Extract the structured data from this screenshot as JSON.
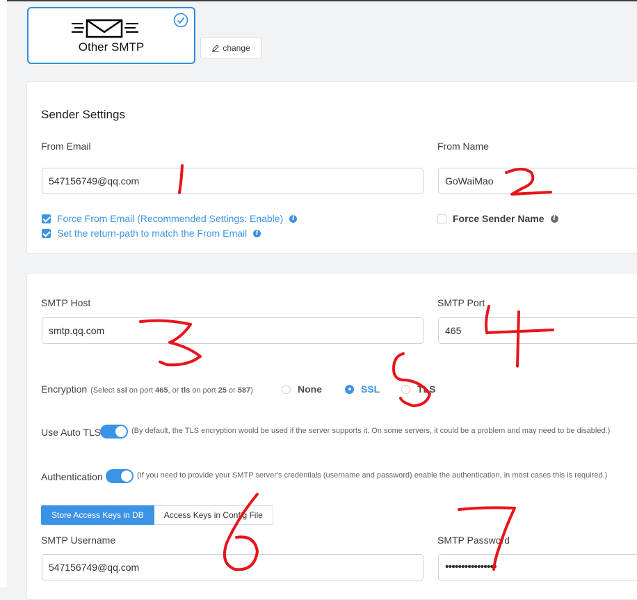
{
  "provider": {
    "name": "Other SMTP",
    "change_label": "change"
  },
  "sender": {
    "title": "Sender Settings",
    "from_email_label": "From Email",
    "from_email_value": "547156749@qq.com",
    "from_name_label": "From Name",
    "from_name_value": "GoWaiMao",
    "force_from_email_label": "Force From Email (Recommended Settings: Enable)",
    "force_from_email_checked": true,
    "return_path_label": "Set the return-path to match the From Email",
    "return_path_checked": true,
    "force_sender_name_label": "Force Sender Name",
    "force_sender_name_checked": false
  },
  "smtp": {
    "host_label": "SMTP Host",
    "host_value": "smtp.qq.com",
    "port_label": "SMTP Port",
    "port_value": "465",
    "encryption_label": "Encryption",
    "encryption_hint_parts": [
      "(Select ",
      "ssl",
      " on port ",
      "465",
      ", or ",
      "tls",
      " on port ",
      "25",
      " or ",
      "587",
      ")"
    ],
    "encryption_options": [
      "None",
      "SSL",
      "TLS"
    ],
    "encryption_selected": "SSL",
    "auto_tls_label": "Use Auto TLS",
    "auto_tls_hint": "(By default, the TLS encryption would be used if the server supports it. On some servers, it could be a problem and may need to be disabled.)",
    "auto_tls_on": true,
    "auth_label": "Authentication",
    "auth_hint": "(If you need to provide your SMTP server's credentials (username and password) enable the authentication, in most cases this is required.)",
    "auth_on": true,
    "key_tabs": [
      "Store Access Keys in DB",
      "Access Keys in Config File"
    ],
    "key_tab_active": "Store Access Keys in DB",
    "username_label": "SMTP Username",
    "username_value": "547156749@qq.com",
    "password_label": "SMTP Password",
    "password_value": "••••••••••••••••"
  },
  "annotations": {
    "color": "#e8141a",
    "numbers": [
      "1",
      "2",
      "3",
      "4",
      "5",
      "6",
      "7"
    ]
  },
  "colors": {
    "accent": "#3b93e6",
    "annotation": "#e8141a"
  }
}
